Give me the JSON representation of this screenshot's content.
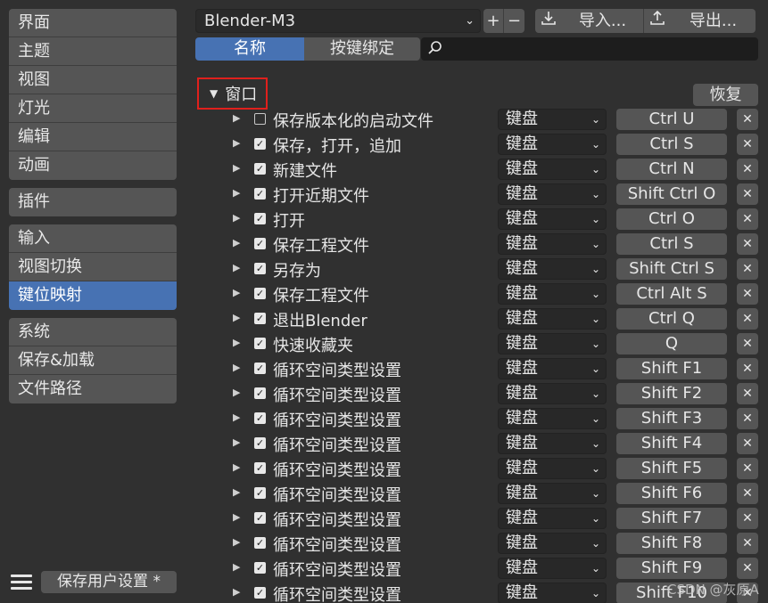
{
  "sidebar": {
    "groups": [
      {
        "items": [
          {
            "label": "界面"
          },
          {
            "label": "主题"
          },
          {
            "label": "视图"
          },
          {
            "label": "灯光"
          },
          {
            "label": "编辑"
          },
          {
            "label": "动画"
          }
        ]
      },
      {
        "items": [
          {
            "label": "插件"
          }
        ]
      },
      {
        "items": [
          {
            "label": "输入"
          },
          {
            "label": "视图切换"
          },
          {
            "label": "键位映射",
            "active": true
          }
        ]
      },
      {
        "items": [
          {
            "label": "系统"
          },
          {
            "label": "保存&加载"
          },
          {
            "label": "文件路径"
          }
        ]
      }
    ],
    "save_prefs_label": "保存用户设置 *"
  },
  "toolbar": {
    "preset_name": "Blender-M3",
    "add_label": "+",
    "remove_label": "−",
    "import_label": "导入...",
    "export_label": "导出..."
  },
  "search": {
    "mode_name_label": "名称",
    "mode_key_label": "按键绑定",
    "value": ""
  },
  "category": {
    "title": "窗口",
    "restore_label": "恢复"
  },
  "keymap_items": [
    {
      "name": "保存版本化的启动文件",
      "enabled": false,
      "device": "键盘",
      "key": "Ctrl U"
    },
    {
      "name": "保存，打开，追加",
      "enabled": true,
      "device": "键盘",
      "key": "Ctrl S"
    },
    {
      "name": "新建文件",
      "enabled": true,
      "device": "键盘",
      "key": "Ctrl N"
    },
    {
      "name": "打开近期文件",
      "enabled": true,
      "device": "键盘",
      "key": "Shift Ctrl O"
    },
    {
      "name": "打开",
      "enabled": true,
      "device": "键盘",
      "key": "Ctrl O"
    },
    {
      "name": "保存工程文件",
      "enabled": true,
      "device": "键盘",
      "key": "Ctrl S"
    },
    {
      "name": "另存为",
      "enabled": true,
      "device": "键盘",
      "key": "Shift Ctrl S"
    },
    {
      "name": "保存工程文件",
      "enabled": true,
      "device": "键盘",
      "key": "Ctrl Alt S"
    },
    {
      "name": "退出Blender",
      "enabled": true,
      "device": "键盘",
      "key": "Ctrl Q"
    },
    {
      "name": "快速收藏夹",
      "enabled": true,
      "device": "键盘",
      "key": "Q"
    },
    {
      "name": "循环空间类型设置",
      "enabled": true,
      "device": "键盘",
      "key": "Shift F1"
    },
    {
      "name": "循环空间类型设置",
      "enabled": true,
      "device": "键盘",
      "key": "Shift F2"
    },
    {
      "name": "循环空间类型设置",
      "enabled": true,
      "device": "键盘",
      "key": "Shift F3"
    },
    {
      "name": "循环空间类型设置",
      "enabled": true,
      "device": "键盘",
      "key": "Shift F4"
    },
    {
      "name": "循环空间类型设置",
      "enabled": true,
      "device": "键盘",
      "key": "Shift F5"
    },
    {
      "name": "循环空间类型设置",
      "enabled": true,
      "device": "键盘",
      "key": "Shift F6"
    },
    {
      "name": "循环空间类型设置",
      "enabled": true,
      "device": "键盘",
      "key": "Shift F7"
    },
    {
      "name": "循环空间类型设置",
      "enabled": true,
      "device": "键盘",
      "key": "Shift F8"
    },
    {
      "name": "循环空间类型设置",
      "enabled": true,
      "device": "键盘",
      "key": "Shift F9"
    },
    {
      "name": "循环空间类型设置",
      "enabled": true,
      "device": "键盘",
      "key": "Shift F10"
    }
  ],
  "watermark": "CSDN @灰原A",
  "icons": {
    "expand": "triangle-right-icon",
    "collapse": "triangle-down-icon",
    "dropdown": "chevron-down-icon",
    "delete": "close-icon",
    "search": "search-icon",
    "import": "download-icon",
    "export": "upload-icon",
    "menu": "hamburger-icon"
  },
  "colors": {
    "background": "#303030",
    "button": "#555555",
    "accent": "#4772b3",
    "highlight_border": "#e0201c"
  }
}
